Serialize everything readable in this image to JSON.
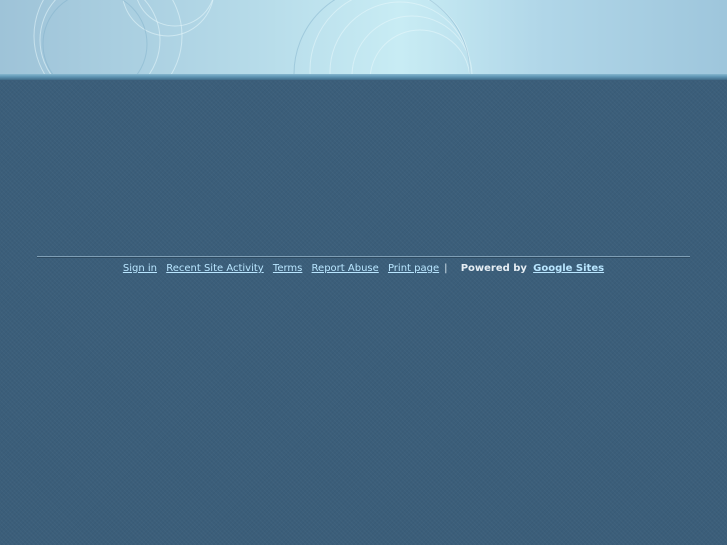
{
  "header": {
    "banner_icon": "decorative-circles-icon"
  },
  "footer": {
    "links": [
      {
        "label": "Sign in"
      },
      {
        "label": "Recent Site Activity"
      },
      {
        "label": "Terms"
      },
      {
        "label": "Report Abuse"
      },
      {
        "label": "Print page"
      }
    ],
    "separator": "|",
    "powered_by_label": "Powered by",
    "brand_label": "Google Sites"
  },
  "colors": {
    "page_background": "#3b5e7a",
    "banner_light": "#c8ecf4",
    "banner_mid": "#9ec3d8",
    "link": "#b9e6ff"
  }
}
